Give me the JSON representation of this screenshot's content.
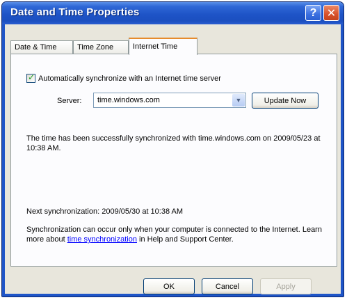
{
  "window": {
    "title": "Date and Time Properties",
    "help_glyph": "?",
    "close_glyph": "✕"
  },
  "tabs": [
    {
      "label": "Date & Time",
      "active": false
    },
    {
      "label": "Time Zone",
      "active": false
    },
    {
      "label": "Internet Time",
      "active": true
    }
  ],
  "internet_time": {
    "auto_sync_label": "Automatically synchronize with an Internet time server",
    "auto_sync_checked": true,
    "server_label": "Server:",
    "server_value": "time.windows.com",
    "update_button": "Update Now",
    "status_message": "The time has been successfully synchronized with time.windows.com on 2009/05/23 at 10:38 AM.",
    "next_sync": "Next synchronization: 2009/05/30 at 10:38 AM",
    "info_text_before": "Synchronization can occur only when your computer is connected to the Internet.  Learn more about ",
    "info_link": "time synchronization",
    "info_text_after": " in Help and Support Center."
  },
  "buttons": {
    "ok": "OK",
    "cancel": "Cancel",
    "apply": "Apply"
  },
  "colors": {
    "titlebar": "#1e54c7",
    "dialog_bg": "#e8e6dc",
    "active_tab_accent": "#e68b2c",
    "link": "#0000ff"
  }
}
